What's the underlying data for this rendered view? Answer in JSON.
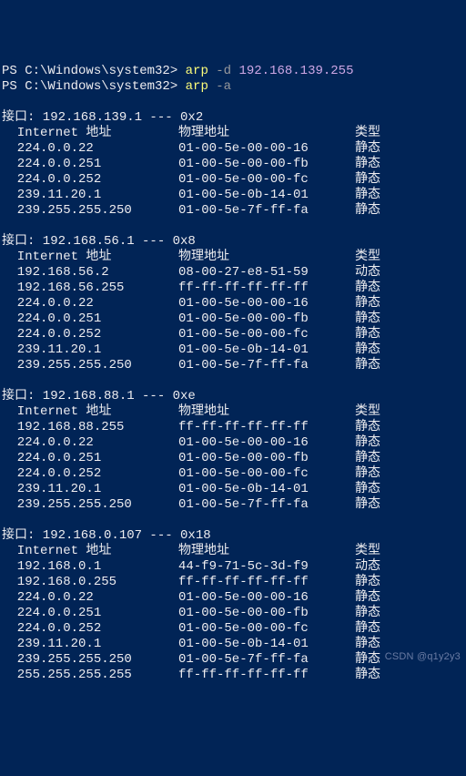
{
  "prompt1": {
    "path": "PS C:\\Windows\\system32>",
    "cmd": "arp",
    "flag": "-d",
    "arg": "192.168.139.255"
  },
  "prompt2": {
    "path": "PS C:\\Windows\\system32>",
    "cmd": "arp",
    "flag": "-a"
  },
  "labels": {
    "iface_prefix": "接口:",
    "sep": "---"
  },
  "headers": {
    "ip": "  Internet 地址",
    "mac": "物理地址",
    "type": "类型"
  },
  "interfaces": [
    {
      "ip": "192.168.139.1",
      "idx": "0x2",
      "rows": [
        {
          "ip": "  224.0.0.22",
          "mac": "01-00-5e-00-00-16",
          "type": "静态"
        },
        {
          "ip": "  224.0.0.251",
          "mac": "01-00-5e-00-00-fb",
          "type": "静态"
        },
        {
          "ip": "  224.0.0.252",
          "mac": "01-00-5e-00-00-fc",
          "type": "静态"
        },
        {
          "ip": "  239.11.20.1",
          "mac": "01-00-5e-0b-14-01",
          "type": "静态"
        },
        {
          "ip": "  239.255.255.250",
          "mac": "01-00-5e-7f-ff-fa",
          "type": "静态"
        }
      ]
    },
    {
      "ip": "192.168.56.1",
      "idx": "0x8",
      "rows": [
        {
          "ip": "  192.168.56.2",
          "mac": "08-00-27-e8-51-59",
          "type": "动态"
        },
        {
          "ip": "  192.168.56.255",
          "mac": "ff-ff-ff-ff-ff-ff",
          "type": "静态"
        },
        {
          "ip": "  224.0.0.22",
          "mac": "01-00-5e-00-00-16",
          "type": "静态"
        },
        {
          "ip": "  224.0.0.251",
          "mac": "01-00-5e-00-00-fb",
          "type": "静态"
        },
        {
          "ip": "  224.0.0.252",
          "mac": "01-00-5e-00-00-fc",
          "type": "静态"
        },
        {
          "ip": "  239.11.20.1",
          "mac": "01-00-5e-0b-14-01",
          "type": "静态"
        },
        {
          "ip": "  239.255.255.250",
          "mac": "01-00-5e-7f-ff-fa",
          "type": "静态"
        }
      ]
    },
    {
      "ip": "192.168.88.1",
      "idx": "0xe",
      "rows": [
        {
          "ip": "  192.168.88.255",
          "mac": "ff-ff-ff-ff-ff-ff",
          "type": "静态"
        },
        {
          "ip": "  224.0.0.22",
          "mac": "01-00-5e-00-00-16",
          "type": "静态"
        },
        {
          "ip": "  224.0.0.251",
          "mac": "01-00-5e-00-00-fb",
          "type": "静态"
        },
        {
          "ip": "  224.0.0.252",
          "mac": "01-00-5e-00-00-fc",
          "type": "静态"
        },
        {
          "ip": "  239.11.20.1",
          "mac": "01-00-5e-0b-14-01",
          "type": "静态"
        },
        {
          "ip": "  239.255.255.250",
          "mac": "01-00-5e-7f-ff-fa",
          "type": "静态"
        }
      ]
    },
    {
      "ip": "192.168.0.107",
      "idx": "0x18",
      "rows": [
        {
          "ip": "  192.168.0.1",
          "mac": "44-f9-71-5c-3d-f9",
          "type": "动态"
        },
        {
          "ip": "  192.168.0.255",
          "mac": "ff-ff-ff-ff-ff-ff",
          "type": "静态"
        },
        {
          "ip": "  224.0.0.22",
          "mac": "01-00-5e-00-00-16",
          "type": "静态"
        },
        {
          "ip": "  224.0.0.251",
          "mac": "01-00-5e-00-00-fb",
          "type": "静态"
        },
        {
          "ip": "  224.0.0.252",
          "mac": "01-00-5e-00-00-fc",
          "type": "静态"
        },
        {
          "ip": "  239.11.20.1",
          "mac": "01-00-5e-0b-14-01",
          "type": "静态"
        },
        {
          "ip": "  239.255.255.250",
          "mac": "01-00-5e-7f-ff-fa",
          "type": "静态"
        },
        {
          "ip": "  255.255.255.255",
          "mac": "ff-ff-ff-ff-ff-ff",
          "type": "静态"
        }
      ]
    }
  ],
  "watermark": "CSDN @q1y2y3"
}
